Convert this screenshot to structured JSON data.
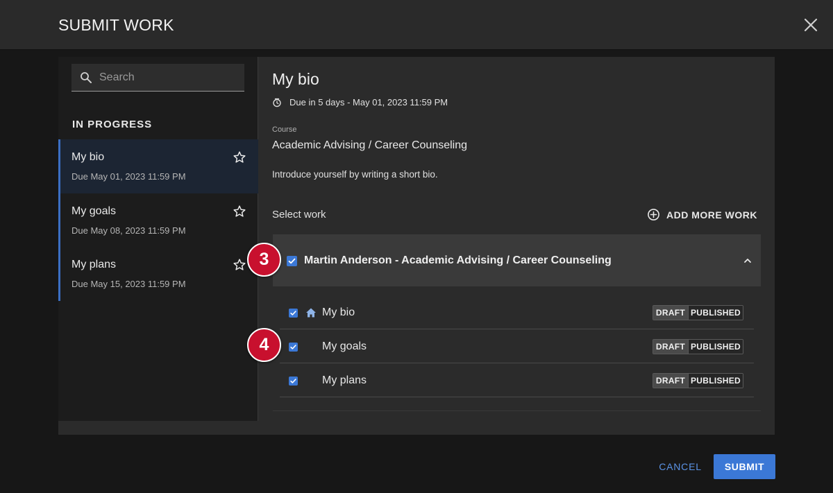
{
  "dialog": {
    "title": "SUBMIT WORK"
  },
  "sidebar": {
    "search_placeholder": "Search",
    "section_label": "IN PROGRESS",
    "items": [
      {
        "name": "My bio",
        "due": "Due May 01, 2023 11:59 PM",
        "selected": true
      },
      {
        "name": "My goals",
        "due": "Due May 08, 2023 11:59 PM",
        "selected": false
      },
      {
        "name": "My plans",
        "due": "Due May 15, 2023 11:59 PM",
        "selected": false
      }
    ]
  },
  "detail": {
    "title": "My bio",
    "due_text": "Due in 5 days - May 01, 2023 11:59 PM",
    "course_label": "Course",
    "course_name": "Academic Advising / Career Counseling",
    "description": "Introduce yourself by writing a short bio.",
    "select_work_label": "Select work",
    "add_more_label": "ADD MORE WORK",
    "group": {
      "title": "Martin Anderson - Academic Advising / Career Counseling",
      "checked": true
    },
    "works": [
      {
        "name": "My bio",
        "icon": "home-icon",
        "checked": true,
        "draft_label": "DRAFT",
        "published_label": "PUBLISHED"
      },
      {
        "name": "My goals",
        "icon": null,
        "checked": true,
        "draft_label": "DRAFT",
        "published_label": "PUBLISHED"
      },
      {
        "name": "My plans",
        "icon": null,
        "checked": true,
        "draft_label": "DRAFT",
        "published_label": "PUBLISHED"
      }
    ]
  },
  "annotations": {
    "step_3": "3",
    "step_4": "4"
  },
  "footer": {
    "cancel_label": "CANCEL",
    "submit_label": "SUBMIT"
  },
  "colors": {
    "accent": "#3b78d6",
    "badge": "#c8102e",
    "link": "#5b93e6"
  }
}
